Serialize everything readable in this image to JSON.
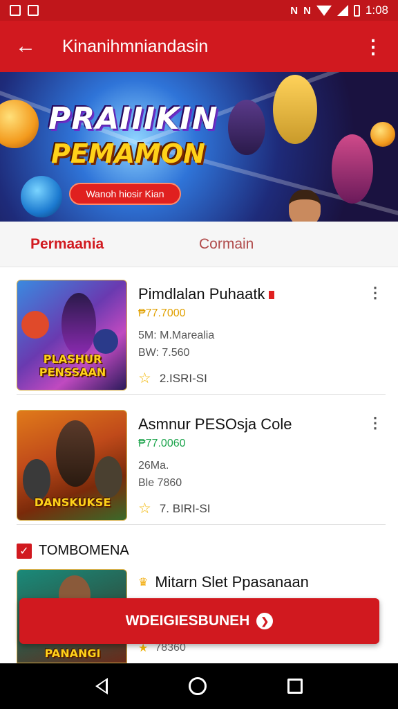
{
  "status_bar": {
    "time": "1:08",
    "glyph_a": "N",
    "glyph_b": "N"
  },
  "app_bar": {
    "title": "Kinanihmniandasin"
  },
  "banner": {
    "title_line1": "PRAIIIKIN",
    "title_line2": "PEMAMON",
    "pill_label": "Wanoh hiosir Kian"
  },
  "tabs": [
    {
      "label": "Permaania",
      "active": true
    },
    {
      "label": "Cormain",
      "active": false
    }
  ],
  "games": [
    {
      "name": "Pimdlalan Puhaatk",
      "price": "₱77.7000",
      "price_color": "#e0a000",
      "meta1": "5M: M.Marealia",
      "meta2": "BW: 7.560",
      "rating": "2.ISRI-SI",
      "thumb_title": "PLASHUR PENSSAAN"
    },
    {
      "name": "Asmnur PESOsja Cole",
      "price": "₱77.0060",
      "price_color": "#1aa34a",
      "meta1": "26Ma.",
      "meta2": "Ble 7860",
      "rating": "7. BIRI-SI",
      "thumb_title": "DANSKUKSE"
    }
  ],
  "section": {
    "label": "TOMBOMENA"
  },
  "partial_game": {
    "name": "Mitarn Slet Ppasanaan",
    "price": "78360",
    "thumb_title": "PANANGI"
  },
  "cta": {
    "label": "WDEIGIESBUNEH"
  },
  "colors": {
    "primary": "#d1191f",
    "status_bar": "#c0161b"
  }
}
